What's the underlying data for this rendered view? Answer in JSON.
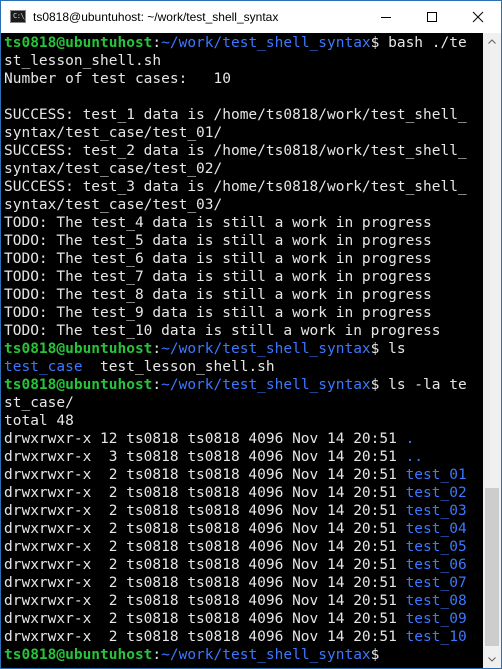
{
  "window": {
    "title": "ts0818@ubuntuhost: ~/work/test_shell_syntax",
    "icon_name": "console-icon",
    "icon_text": "C:\\_"
  },
  "colors": {
    "background": "#000000",
    "text": "#e6e6e6",
    "prompt_user": "#27c43a",
    "path_and_dirs": "#3b78ff"
  },
  "terminal": {
    "lines": [
      [
        {
          "t": "ts0818@ubuntuhost",
          "c": "g"
        },
        {
          "t": ":",
          "c": "w"
        },
        {
          "t": "~/work/test_shell_syntax",
          "c": "b"
        },
        {
          "t": "$ bash ./te",
          "c": "w"
        }
      ],
      [
        {
          "t": "st_lesson_shell.sh",
          "c": "w"
        }
      ],
      [
        {
          "t": "Number of test cases:   10",
          "c": "w"
        }
      ],
      [
        {
          "t": "",
          "c": "w"
        }
      ],
      [
        {
          "t": "SUCCESS: test_1 data is /home/ts0818/work/test_shell_",
          "c": "w"
        }
      ],
      [
        {
          "t": "syntax/test_case/test_01/",
          "c": "w"
        }
      ],
      [
        {
          "t": "SUCCESS: test_2 data is /home/ts0818/work/test_shell_",
          "c": "w"
        }
      ],
      [
        {
          "t": "syntax/test_case/test_02/",
          "c": "w"
        }
      ],
      [
        {
          "t": "SUCCESS: test_3 data is /home/ts0818/work/test_shell_",
          "c": "w"
        }
      ],
      [
        {
          "t": "syntax/test_case/test_03/",
          "c": "w"
        }
      ],
      [
        {
          "t": "TODO: The test_4 data is still a work in progress",
          "c": "w"
        }
      ],
      [
        {
          "t": "TODO: The test_5 data is still a work in progress",
          "c": "w"
        }
      ],
      [
        {
          "t": "TODO: The test_6 data is still a work in progress",
          "c": "w"
        }
      ],
      [
        {
          "t": "TODO: The test_7 data is still a work in progress",
          "c": "w"
        }
      ],
      [
        {
          "t": "TODO: The test_8 data is still a work in progress",
          "c": "w"
        }
      ],
      [
        {
          "t": "TODO: The test_9 data is still a work in progress",
          "c": "w"
        }
      ],
      [
        {
          "t": "TODO: The test_10 data is still a work in progress",
          "c": "w"
        }
      ],
      [
        {
          "t": "ts0818@ubuntuhost",
          "c": "g"
        },
        {
          "t": ":",
          "c": "w"
        },
        {
          "t": "~/work/test_shell_syntax",
          "c": "b"
        },
        {
          "t": "$ ls",
          "c": "w"
        }
      ],
      [
        {
          "t": "test_case",
          "c": "b"
        },
        {
          "t": "  test_lesson_shell.sh",
          "c": "w"
        }
      ],
      [
        {
          "t": "ts0818@ubuntuhost",
          "c": "g"
        },
        {
          "t": ":",
          "c": "w"
        },
        {
          "t": "~/work/test_shell_syntax",
          "c": "b"
        },
        {
          "t": "$ ls -la te",
          "c": "w"
        }
      ],
      [
        {
          "t": "st_case/",
          "c": "w"
        }
      ],
      [
        {
          "t": "total 48",
          "c": "w"
        }
      ],
      [
        {
          "t": "drwxrwxr-x 12 ts0818 ts0818 4096 Nov 14 20:51 ",
          "c": "w"
        },
        {
          "t": ".",
          "c": "b"
        }
      ],
      [
        {
          "t": "drwxrwxr-x  3 ts0818 ts0818 4096 Nov 14 20:51 ",
          "c": "w"
        },
        {
          "t": "..",
          "c": "b"
        }
      ],
      [
        {
          "t": "drwxrwxr-x  2 ts0818 ts0818 4096 Nov 14 20:51 ",
          "c": "w"
        },
        {
          "t": "test_01",
          "c": "b"
        }
      ],
      [
        {
          "t": "drwxrwxr-x  2 ts0818 ts0818 4096 Nov 14 20:51 ",
          "c": "w"
        },
        {
          "t": "test_02",
          "c": "b"
        }
      ],
      [
        {
          "t": "drwxrwxr-x  2 ts0818 ts0818 4096 Nov 14 20:51 ",
          "c": "w"
        },
        {
          "t": "test_03",
          "c": "b"
        }
      ],
      [
        {
          "t": "drwxrwxr-x  2 ts0818 ts0818 4096 Nov 14 20:51 ",
          "c": "w"
        },
        {
          "t": "test_04",
          "c": "b"
        }
      ],
      [
        {
          "t": "drwxrwxr-x  2 ts0818 ts0818 4096 Nov 14 20:51 ",
          "c": "w"
        },
        {
          "t": "test_05",
          "c": "b"
        }
      ],
      [
        {
          "t": "drwxrwxr-x  2 ts0818 ts0818 4096 Nov 14 20:51 ",
          "c": "w"
        },
        {
          "t": "test_06",
          "c": "b"
        }
      ],
      [
        {
          "t": "drwxrwxr-x  2 ts0818 ts0818 4096 Nov 14 20:51 ",
          "c": "w"
        },
        {
          "t": "test_07",
          "c": "b"
        }
      ],
      [
        {
          "t": "drwxrwxr-x  2 ts0818 ts0818 4096 Nov 14 20:51 ",
          "c": "w"
        },
        {
          "t": "test_08",
          "c": "b"
        }
      ],
      [
        {
          "t": "drwxrwxr-x  2 ts0818 ts0818 4096 Nov 14 20:51 ",
          "c": "w"
        },
        {
          "t": "test_09",
          "c": "b"
        }
      ],
      [
        {
          "t": "drwxrwxr-x  2 ts0818 ts0818 4096 Nov 14 20:51 ",
          "c": "w"
        },
        {
          "t": "test_10",
          "c": "b"
        }
      ],
      [
        {
          "t": "ts0818@ubuntuhost",
          "c": "g"
        },
        {
          "t": ":",
          "c": "w"
        },
        {
          "t": "~/work/test_shell_syntax",
          "c": "b"
        },
        {
          "t": "$ ",
          "c": "w"
        }
      ]
    ]
  }
}
